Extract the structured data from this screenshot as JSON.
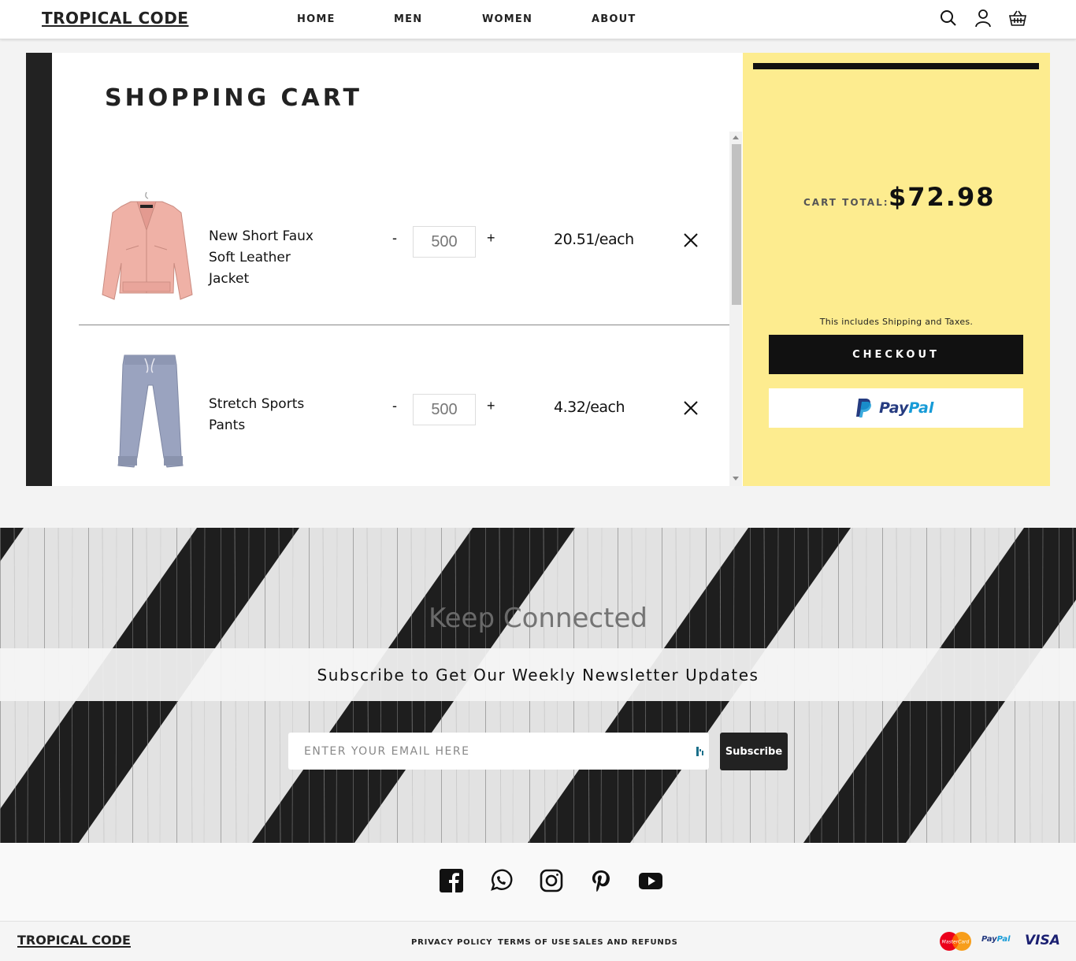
{
  "header": {
    "logo": "TROPICAL CODE",
    "nav": [
      "HOME",
      "MEN",
      "WOMEN",
      "ABOUT"
    ],
    "icons": [
      "search-icon",
      "user-icon",
      "basket-icon"
    ]
  },
  "cart": {
    "title": "SHOPPING CART",
    "items": [
      {
        "name": "New Short Faux Soft Leather Jacket",
        "quantity": "500",
        "price": "20.51/each",
        "minus": "-",
        "plus": "+"
      },
      {
        "name": "Stretch Sports Pants",
        "quantity": "500",
        "price": "4.32/each",
        "minus": "-",
        "plus": "+"
      }
    ]
  },
  "summary": {
    "total_label": "CART TOTAL:",
    "total_value": "$72.98",
    "note": "This includes Shipping and Taxes.",
    "checkout_label": "CHECKOUT",
    "paypal_part1": "Pay",
    "paypal_part2": "Pal"
  },
  "newsletter": {
    "heading": "Keep Connected",
    "subtitle": "Subscribe to Get Our Weekly Newsletter Updates",
    "email_placeholder": "ENTER YOUR EMAIL HERE",
    "subscribe_label": "Subscribe"
  },
  "social": [
    "facebook-icon",
    "whatsapp-icon",
    "instagram-icon",
    "pinterest-icon",
    "youtube-icon"
  ],
  "footer": {
    "logo": "TROPICAL CODE",
    "links": [
      "PRIVACY POLICY",
      "TERMS OF USE",
      "SALES AND REFUNDS"
    ],
    "payments": {
      "mastercard": "MasterCard",
      "paypal_a": "Pay",
      "paypal_b": "Pal",
      "visa": "VISA"
    }
  },
  "colors": {
    "summary_bg": "#fdec8f",
    "dark": "#111111",
    "paypal_dark": "#253b80",
    "paypal_light": "#179bd7"
  }
}
